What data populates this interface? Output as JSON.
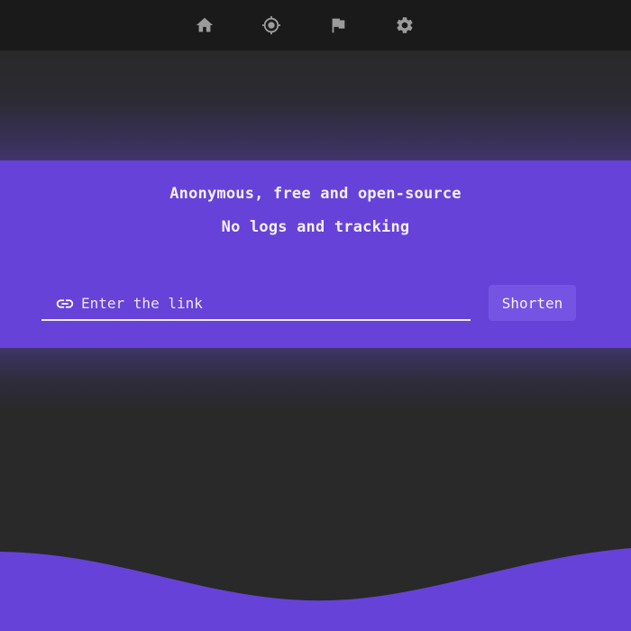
{
  "nav": {
    "items": [
      {
        "icon": "home-icon"
      },
      {
        "icon": "target-icon"
      },
      {
        "icon": "flag-icon"
      },
      {
        "icon": "gear-icon"
      }
    ]
  },
  "hero": {
    "line1": "Anonymous, free and open-source",
    "line2": "No logs and tracking"
  },
  "form": {
    "link_placeholder": "Enter the link",
    "link_value": "",
    "link_icon": "link-icon",
    "submit_label": "Shorten"
  },
  "colors": {
    "background": "#292929",
    "nav_background": "#1a1a1a",
    "accent": "#6742d9",
    "button": "#7554e3",
    "icon": "#9b9b9b",
    "text": "#ffffff"
  }
}
